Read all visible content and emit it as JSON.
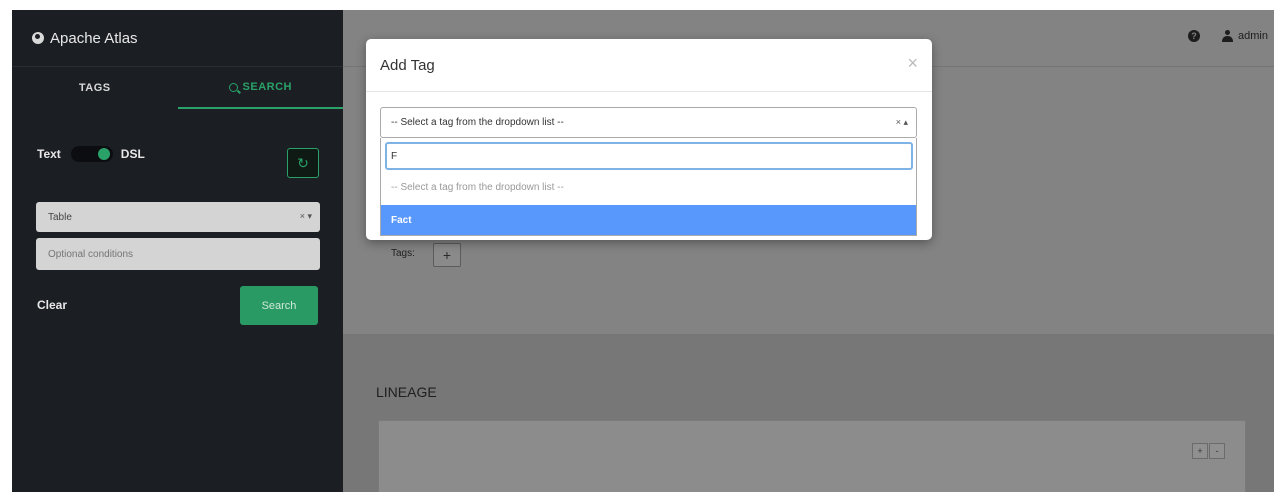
{
  "sidebar": {
    "brand": "Apache Atlas",
    "tabs": [
      {
        "label": "TAGS"
      },
      {
        "label": "SEARCH"
      }
    ],
    "toggle": {
      "left_label": "Text",
      "right_label": "DSL"
    },
    "type_select": {
      "value": "Table",
      "controls": "× ▾"
    },
    "conditions": {
      "placeholder": "Optional conditions"
    },
    "clear_label": "Clear",
    "search_label": "Search"
  },
  "header": {
    "help_icon": "?",
    "user": "admin"
  },
  "main": {
    "tags_label": "Tags:",
    "add_tag": "+",
    "lineage_title": "LINEAGE",
    "zoom_in": "+",
    "zoom_out": "-"
  },
  "modal": {
    "title": "Add Tag",
    "close": "×",
    "select": {
      "value": "-- Select a tag from the dropdown list --",
      "controls": "× ▴"
    },
    "search_value": "F",
    "options": [
      {
        "label": "-- Select a tag from the dropdown list --"
      },
      {
        "label": "Fact"
      }
    ]
  },
  "colors": {
    "accent_green": "#2aa168",
    "highlight_blue": "#5897fb",
    "sidebar_bg": "#1b1e23"
  }
}
